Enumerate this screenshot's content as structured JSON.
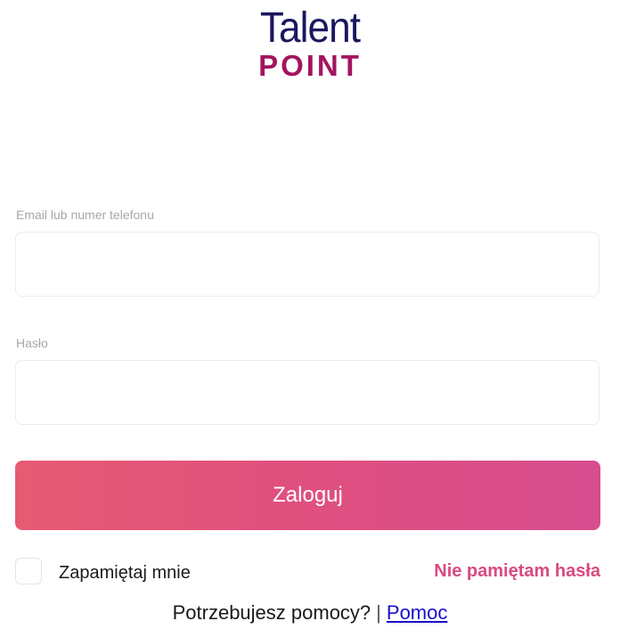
{
  "logo": {
    "line1": "Talent",
    "line2": "POINT"
  },
  "form": {
    "email_label": "Email lub numer telefonu",
    "email_value": "",
    "password_label": "Hasło",
    "password_value": "",
    "submit_label": "Zaloguj",
    "remember_label": "Zapamiętaj mnie",
    "remember_checked": false,
    "forgot_label": "Nie pamiętam hasła"
  },
  "help": {
    "prefix": "Potrzebujesz pomocy?",
    "separator": "|",
    "link_label": "Pomoc"
  },
  "colors": {
    "brand_navy": "#1b1760",
    "brand_magenta": "#a3155f",
    "accent_pink": "#d9497f",
    "button_gradient_start": "#e65a72",
    "button_gradient_end": "#d74d8e",
    "link_blue": "#1a0dcc"
  }
}
